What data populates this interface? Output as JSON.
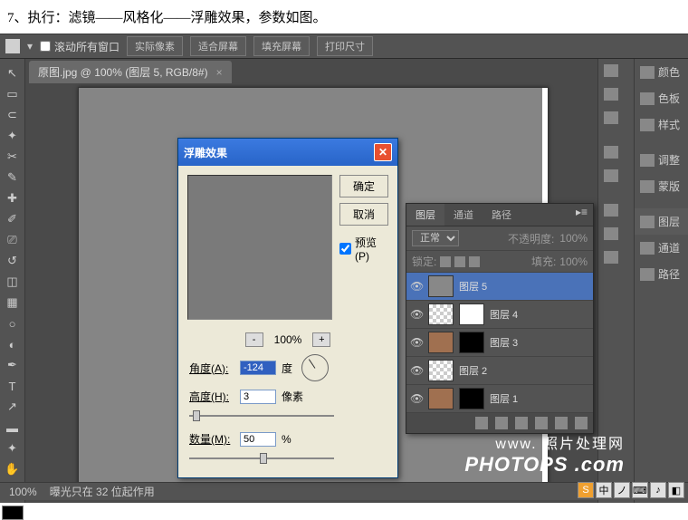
{
  "instruction": "7、执行：滤镜——风格化——浮雕效果，参数如图。",
  "toolbar": {
    "scroll_all_label": "滚动所有窗口",
    "buttons": [
      "实际像素",
      "适合屏幕",
      "填充屏幕",
      "打印尺寸"
    ]
  },
  "doc_tab": {
    "label": "原图.jpg @ 100% (图层 5, RGB/8#)",
    "close": "×"
  },
  "dialog": {
    "title": "浮雕效果",
    "ok": "确定",
    "cancel": "取消",
    "preview_label": "预览(P)",
    "zoom_pct": "100%",
    "angle_label": "角度(A):",
    "angle_value": "-124",
    "angle_unit": "度",
    "height_label": "高度(H):",
    "height_value": "3",
    "height_unit": "像素",
    "amount_label": "数量(M):",
    "amount_value": "50",
    "amount_unit": "%"
  },
  "layers_panel": {
    "tabs": [
      "图层",
      "通道",
      "路径"
    ],
    "blend": "正常",
    "opacity_label": "不透明度:",
    "opacity_val": "100%",
    "lock_label": "锁定:",
    "fill_label": "填充:",
    "fill_val": "100%",
    "layers": [
      {
        "name": "图层 5",
        "active": true,
        "thumb": "gray"
      },
      {
        "name": "图层 4",
        "thumb": "checker",
        "mask": true
      },
      {
        "name": "图层 3",
        "thumb": "photo",
        "mask": true
      },
      {
        "name": "图层 2",
        "thumb": "checker"
      },
      {
        "name": "图层 1",
        "thumb": "photo",
        "mask": true
      }
    ]
  },
  "right_panel": {
    "items": [
      "颜色",
      "色板",
      "样式",
      "调整",
      "蒙版",
      "图层",
      "通道",
      "路径"
    ]
  },
  "status": {
    "zoom": "100%",
    "info": "曝光只在 32 位起作用"
  },
  "watermark": {
    "line1": "www.  照片处理网",
    "line2": "PHOTOPS .com"
  },
  "ime": [
    "S",
    "中",
    "ノ",
    "⌨",
    "♪",
    "◧"
  ]
}
